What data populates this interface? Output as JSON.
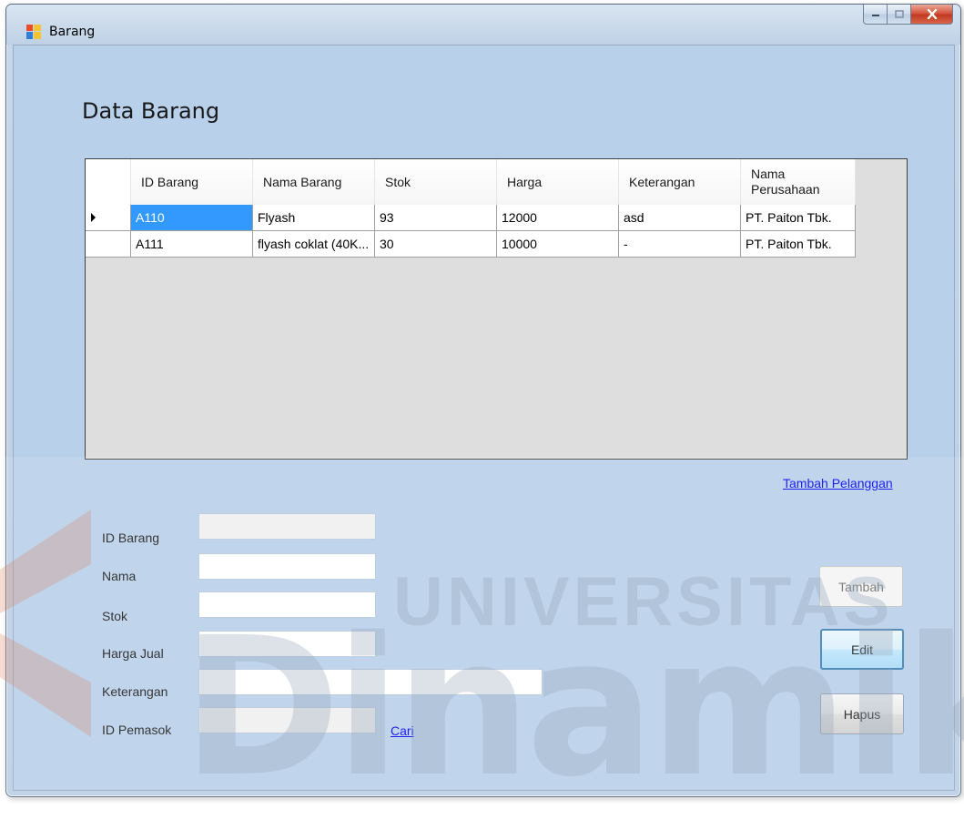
{
  "window": {
    "title": "Barang"
  },
  "page": {
    "title": "Data Barang"
  },
  "grid": {
    "columns": [
      "ID Barang",
      "Nama Barang",
      "Stok",
      "Harga",
      "Keterangan",
      "Nama Perusahaan"
    ],
    "rows": [
      [
        "A110",
        "Flyash",
        "93",
        "12000",
        "asd",
        "PT. Paiton Tbk."
      ],
      [
        "A111",
        "flyash coklat (40K...",
        "30",
        "10000",
        "-",
        "PT. Paiton Tbk."
      ]
    ],
    "selected_row": 0
  },
  "links": {
    "tambah_pelanggan": "Tambah Pelanggan",
    "cari": "Cari"
  },
  "form": {
    "labels": {
      "id_barang": "ID Barang",
      "nama": "Nama",
      "stok": "Stok",
      "harga_jual": "Harga Jual",
      "keterangan": "Keterangan",
      "id_pemasok": "ID Pemasok"
    },
    "values": {
      "id_barang": "",
      "nama": "",
      "stok": "",
      "harga_jual": "",
      "keterangan": "",
      "id_pemasok": ""
    }
  },
  "buttons": {
    "tambah": "Tambah",
    "edit": "Edit",
    "hapus": "Hapus"
  },
  "watermark": {
    "line1": "UNIVERSITAS",
    "line2": "Dinamik"
  },
  "colors": {
    "client_bg": "#b8d0ea",
    "selection": "#3399ff",
    "link": "#0000ee"
  }
}
